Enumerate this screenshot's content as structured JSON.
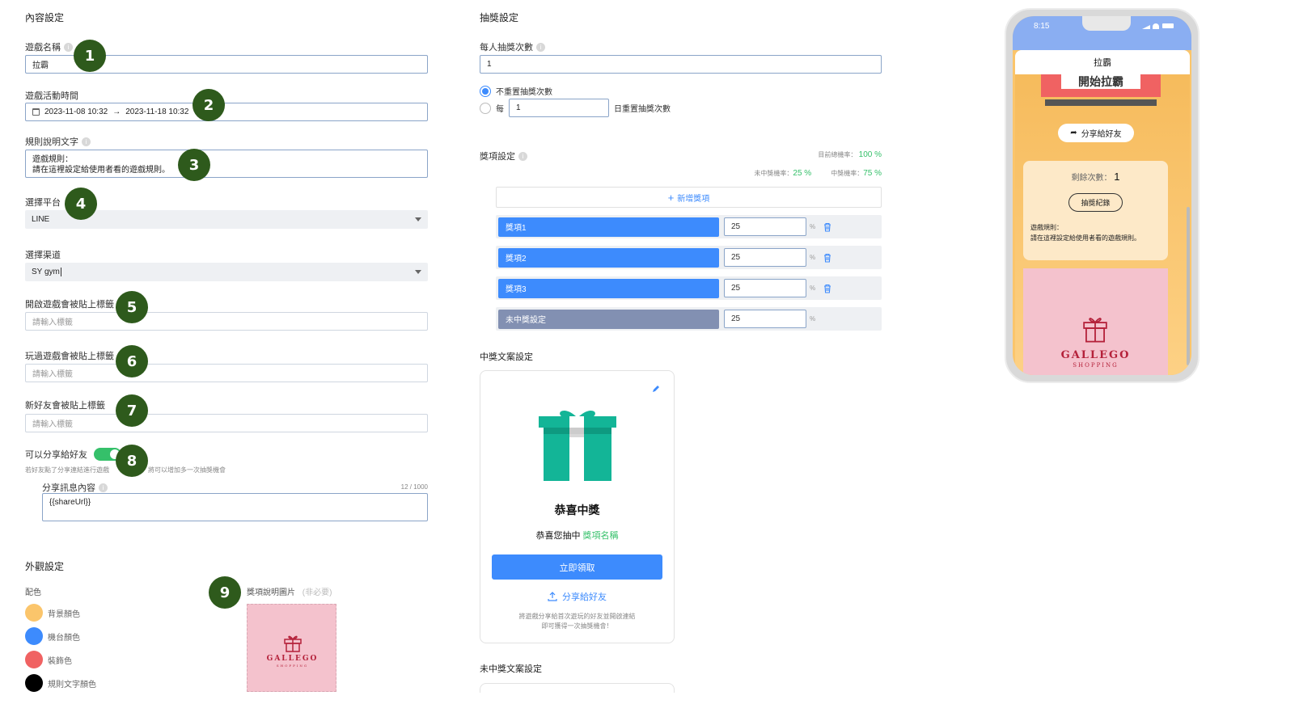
{
  "content": {
    "section_title": "內容設定",
    "game_name": {
      "label": "遊戲名稱",
      "value": "拉霸"
    },
    "game_time": {
      "label": "遊戲活動時間",
      "start": "2023-11-08 10:32",
      "arrow": "→",
      "end": "2023-11-18 10:32"
    },
    "rules": {
      "label": "規則說明文字",
      "line1": "遊戲規則：",
      "line2": "請在這裡設定給使用者看的遊戲規則。"
    },
    "platform": {
      "label": "選擇平台",
      "value": "LINE"
    },
    "channel": {
      "label": "選擇渠道",
      "value": "SY gym"
    },
    "tag_open": {
      "label": "開啟遊戲會被貼上標籤",
      "placeholder": "請輸入標籤"
    },
    "tag_played": {
      "label": "玩過遊戲會被貼上標籤",
      "placeholder": "請輸入標籤"
    },
    "tag_friend": {
      "label": "新好友會被貼上標籤",
      "placeholder": "請輸入標籤"
    },
    "share": {
      "label": "可以分享給好友",
      "hint_left": "若好友點了分享連結進行遊戲",
      "hint_right": "將可以增加多一次抽獎機會",
      "msg_label": "分享訊息內容",
      "msg_count": "12 / 1000",
      "msg_value": "{{shareUrl}}"
    }
  },
  "appearance": {
    "section_title": "外觀設定",
    "colors_label": "配色",
    "colors": [
      {
        "name": "背景顏色",
        "color": "#fbc56b"
      },
      {
        "name": "機台顏色",
        "color": "#3d8bfd"
      },
      {
        "name": "裝飾色",
        "color": "#f06262"
      },
      {
        "name": "規則文字顏色",
        "color": "#000000"
      }
    ],
    "prize_image_label": "獎項說明圖片",
    "prize_image_optional": "(非必要)",
    "logo_text": "GALLEGO",
    "logo_sub": "SHOPPING"
  },
  "steps": [
    "1",
    "2",
    "3",
    "4",
    "5",
    "6",
    "7",
    "8",
    "9"
  ],
  "draw": {
    "section_title": "抽獎設定",
    "per_person_label": "每人抽獎次數",
    "per_person_value": "1",
    "no_reset_label": "不重置抽獎次數",
    "every_label": "每",
    "every_value": "1",
    "day_reset_label": "日重置抽獎次數"
  },
  "prizes": {
    "section_title": "獎項設定",
    "total_label": "目前總機率：",
    "total_value": "100 %",
    "lose_label": "未中獎機率：",
    "lose_value": "25 %",
    "win_label": "中獎機率：",
    "win_value": "75 %",
    "add_label": "新增獎項",
    "rows": [
      {
        "name": "獎項1",
        "value": "25",
        "pct": "%"
      },
      {
        "name": "獎項2",
        "value": "25",
        "pct": "%"
      },
      {
        "name": "獎項3",
        "value": "25",
        "pct": "%"
      },
      {
        "name": "未中獎設定",
        "value": "25",
        "pct": "%"
      }
    ]
  },
  "win_copy": {
    "section_title": "中獎文案設定",
    "title": "恭喜中獎",
    "body_prefix": "恭喜您抽中",
    "body_highlight": "獎項名稱",
    "claim_button": "立即領取",
    "share_link": "分享給好友",
    "note_line1": "將遊戲分享給首次遊玩的好友並開啟連結",
    "note_line2": "即可獲得一次抽獎機會！"
  },
  "lose_copy": {
    "section_title": "未中獎文案設定"
  },
  "phone": {
    "time": "8:15",
    "title": "拉霸",
    "banner": "開始拉霸",
    "share_button": "分享給好友",
    "remaining_label": "剩餘次數：",
    "remaining_value": "1",
    "record_button": "抽獎紀錄",
    "rules_line1": "遊戲規則：",
    "rules_line2": "請在這裡設定給使用者看的遊戲規則。",
    "logo_text": "GALLEGO",
    "logo_sub": "SHOPPING"
  }
}
